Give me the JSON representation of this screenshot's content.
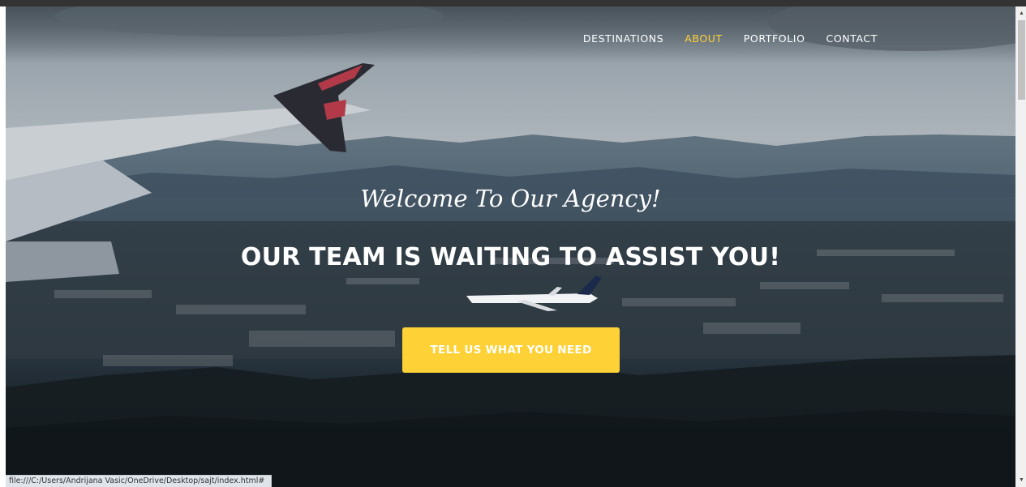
{
  "nav": {
    "items": [
      {
        "label": "DESTINATIONS",
        "active": false
      },
      {
        "label": "ABOUT",
        "active": true
      },
      {
        "label": "PORTFOLIO",
        "active": false
      },
      {
        "label": "CONTACT",
        "active": false
      }
    ]
  },
  "hero": {
    "subheading": "Welcome To Our Agency!",
    "heading": "OUR TEAM IS WAITING TO ASSIST YOU!",
    "cta_label": "TELL US WHAT YOU NEED"
  },
  "status_bar": {
    "url": "file:///C:/Users/Andrijana Vasic/OneDrive/Desktop/sajt/index.html#"
  },
  "colors": {
    "accent": "#fed136",
    "text": "#ffffff"
  },
  "icons": {
    "scroll_up": "triangle-up",
    "scroll_down": "triangle-down"
  }
}
